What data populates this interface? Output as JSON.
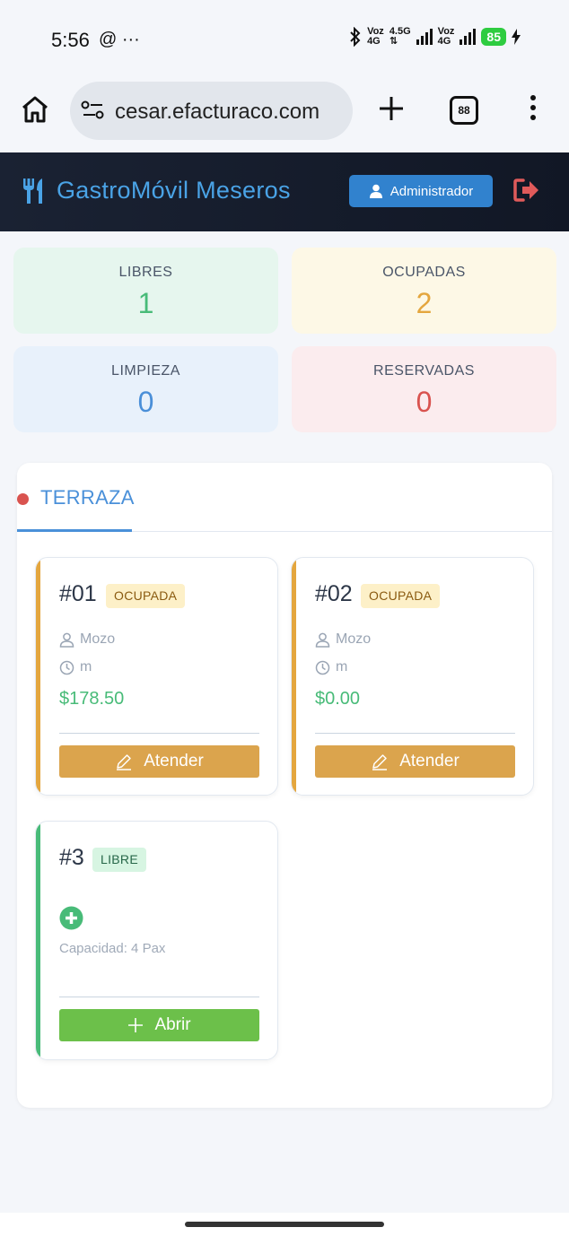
{
  "status_bar": {
    "time": "5:56",
    "left_icons": "@ ···",
    "net1_top": "Voz",
    "net1_bottom": "4G",
    "net2_top": "4.5G",
    "net3_top": "Voz",
    "net3_bottom": "4G",
    "battery": "85"
  },
  "browser": {
    "url": "cesar.efacturaco.com",
    "tab_count": "88"
  },
  "header": {
    "title": "GastroMóvil Meseros",
    "admin_label": "Administrador",
    "accent_color": "#4aa3e6",
    "logout_color": "#e05a5a"
  },
  "stats": {
    "free": {
      "label": "LIBRES",
      "value": "1"
    },
    "busy": {
      "label": "OCUPADAS",
      "value": "2"
    },
    "cleaning": {
      "label": "LIMPIEZA",
      "value": "0"
    },
    "reserved": {
      "label": "RESERVADAS",
      "value": "0"
    }
  },
  "zone": {
    "tab_label": "TERRAZA",
    "tables": [
      {
        "number": "#01",
        "status": "OCUPADA",
        "waiter": "Mozo",
        "time": "m",
        "amount": "$178.50",
        "action": "Atender"
      },
      {
        "number": "#02",
        "status": "OCUPADA",
        "waiter": "Mozo",
        "time": "m",
        "amount": "$0.00",
        "action": "Atender"
      },
      {
        "number": "#3",
        "status": "LIBRE",
        "capacity": "Capacidad: 4 Pax",
        "action": "Abrir"
      }
    ]
  },
  "colors": {
    "busy": "#e4a63e",
    "free": "#48bb78",
    "cleaning": "#4a8fd8",
    "reserved": "#d9534f"
  }
}
